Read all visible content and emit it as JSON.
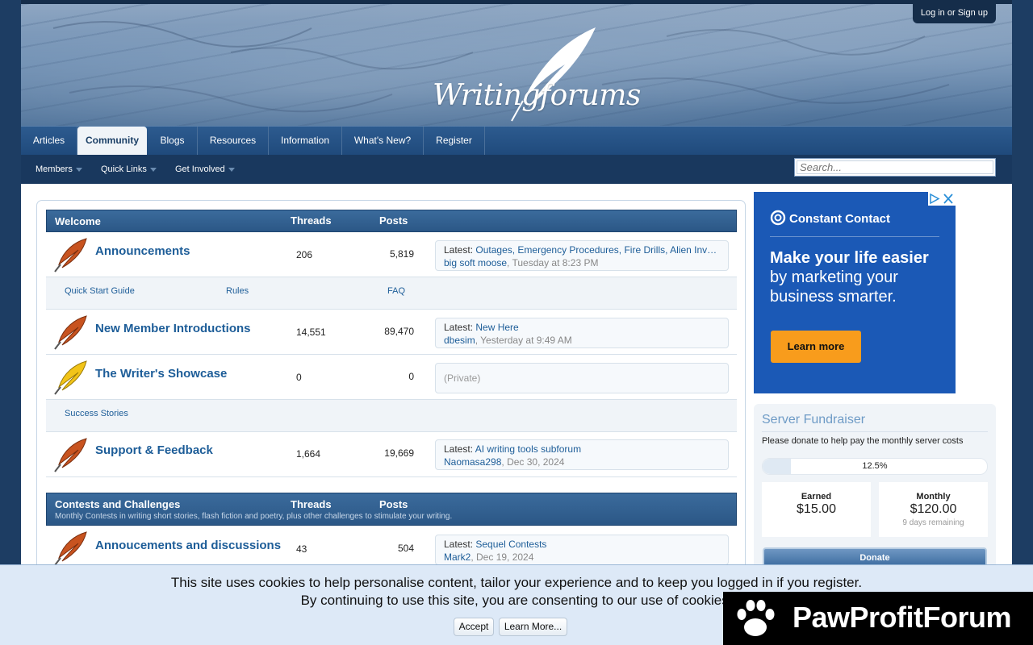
{
  "header": {
    "login_label": "Log in or Sign up",
    "logo_text": "Writingforums"
  },
  "nav": {
    "tabs": [
      {
        "label": "Articles"
      },
      {
        "label": "Community"
      },
      {
        "label": "Blogs"
      },
      {
        "label": "Resources"
      },
      {
        "label": "Information"
      },
      {
        "label": "What's New?"
      },
      {
        "label": "Register"
      }
    ],
    "active_tab": "Community",
    "sub_items": [
      {
        "label": "Members"
      },
      {
        "label": "Quick Links"
      },
      {
        "label": "Get Involved"
      }
    ],
    "search_placeholder": "Search..."
  },
  "categories": [
    {
      "title": "Welcome",
      "threads_label": "Threads",
      "posts_label": "Posts",
      "forums": [
        {
          "name": "Announcements",
          "threads": "206",
          "posts": "5,819",
          "latest_label": "Latest:",
          "latest_title": "Outages, Emergency Procedures, Fire Drills, Alien Inv…",
          "latest_user": "big soft moose",
          "latest_time": "Tuesday at 8:23 PM",
          "icon_color": "orange"
        },
        {
          "name": "New Member Introductions",
          "threads": "14,551",
          "posts": "89,470",
          "latest_label": "Latest:",
          "latest_title": "New Here",
          "latest_user": "dbesim",
          "latest_time": "Yesterday at 9:49 AM",
          "icon_color": "orange"
        },
        {
          "name": "The Writer's Showcase",
          "threads": "0",
          "posts": "0",
          "latest_private": "(Private)",
          "icon_color": "yellow"
        },
        {
          "name": "Support & Feedback",
          "threads": "1,664",
          "posts": "19,669",
          "latest_label": "Latest:",
          "latest_title": "AI writing tools subforum",
          "latest_user": "Naomasa298",
          "latest_time": "Dec 30, 2024",
          "icon_color": "orange"
        }
      ],
      "subforums_1": [
        "Quick Start Guide",
        "Rules",
        "FAQ"
      ],
      "subforums_3": [
        "Success Stories"
      ]
    },
    {
      "title": "Contests and Challenges",
      "description": "Monthly Contests in writing short stories, flash fiction and poetry, plus other challenges to stimulate your writing.",
      "threads_label": "Threads",
      "posts_label": "Posts",
      "forums": [
        {
          "name": "Annoucements and discussions",
          "threads": "43",
          "posts": "504",
          "latest_label": "Latest:",
          "latest_title": "Sequel Contests",
          "latest_user": "Mark2",
          "latest_time": "Dec 19, 2024",
          "icon_color": "orange"
        }
      ]
    }
  ],
  "ad": {
    "brand": "Constant Contact",
    "headline_bold": "Make your life easier",
    "headline_rest": " by marketing your business smarter.",
    "button": "Learn more",
    "colors": {
      "bg": "#1b59b6",
      "button": "#f89c1c"
    }
  },
  "fundraiser": {
    "title": "Server Fundraiser",
    "description": "Please donate to help pay the monthly server costs",
    "progress_pct": "12.5%",
    "progress_value": 0.125,
    "earned_label": "Earned",
    "earned_value": "$15.00",
    "monthly_label": "Monthly",
    "monthly_value": "$120.00",
    "remaining": "9 days remaining",
    "donate_label": "Donate"
  },
  "cookie_notice": {
    "line1": "This site uses cookies to help personalise content, tailor your experience and to keep you logged in if you register.",
    "line2": "By continuing to use this site, you are consenting to our use of cookies.",
    "accept": "Accept",
    "learn_more": "Learn More..."
  },
  "watermark": {
    "text": "PawProfitForum"
  }
}
